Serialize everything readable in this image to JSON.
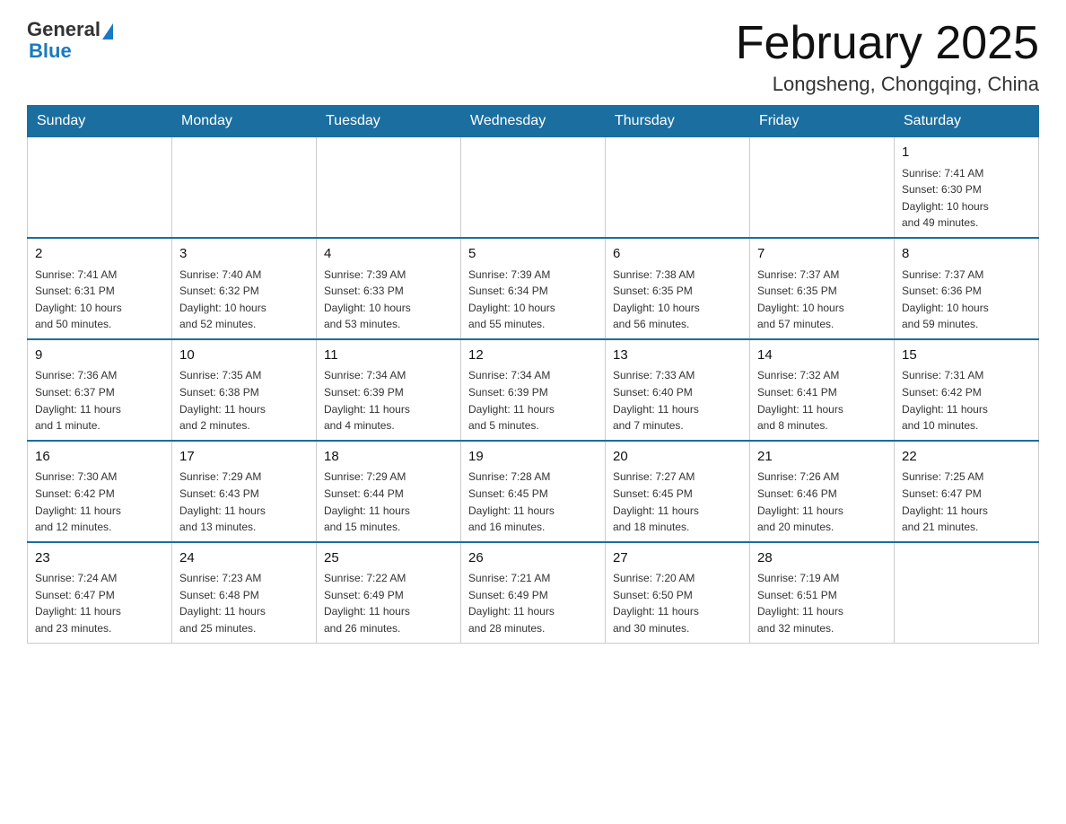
{
  "header": {
    "logo_general": "General",
    "logo_blue": "Blue",
    "month_title": "February 2025",
    "location": "Longsheng, Chongqing, China"
  },
  "days_of_week": [
    "Sunday",
    "Monday",
    "Tuesday",
    "Wednesday",
    "Thursday",
    "Friday",
    "Saturday"
  ],
  "weeks": [
    {
      "days": [
        {
          "date": "",
          "info": ""
        },
        {
          "date": "",
          "info": ""
        },
        {
          "date": "",
          "info": ""
        },
        {
          "date": "",
          "info": ""
        },
        {
          "date": "",
          "info": ""
        },
        {
          "date": "",
          "info": ""
        },
        {
          "date": "1",
          "info": "Sunrise: 7:41 AM\nSunset: 6:30 PM\nDaylight: 10 hours\nand 49 minutes."
        }
      ]
    },
    {
      "days": [
        {
          "date": "2",
          "info": "Sunrise: 7:41 AM\nSunset: 6:31 PM\nDaylight: 10 hours\nand 50 minutes."
        },
        {
          "date": "3",
          "info": "Sunrise: 7:40 AM\nSunset: 6:32 PM\nDaylight: 10 hours\nand 52 minutes."
        },
        {
          "date": "4",
          "info": "Sunrise: 7:39 AM\nSunset: 6:33 PM\nDaylight: 10 hours\nand 53 minutes."
        },
        {
          "date": "5",
          "info": "Sunrise: 7:39 AM\nSunset: 6:34 PM\nDaylight: 10 hours\nand 55 minutes."
        },
        {
          "date": "6",
          "info": "Sunrise: 7:38 AM\nSunset: 6:35 PM\nDaylight: 10 hours\nand 56 minutes."
        },
        {
          "date": "7",
          "info": "Sunrise: 7:37 AM\nSunset: 6:35 PM\nDaylight: 10 hours\nand 57 minutes."
        },
        {
          "date": "8",
          "info": "Sunrise: 7:37 AM\nSunset: 6:36 PM\nDaylight: 10 hours\nand 59 minutes."
        }
      ]
    },
    {
      "days": [
        {
          "date": "9",
          "info": "Sunrise: 7:36 AM\nSunset: 6:37 PM\nDaylight: 11 hours\nand 1 minute."
        },
        {
          "date": "10",
          "info": "Sunrise: 7:35 AM\nSunset: 6:38 PM\nDaylight: 11 hours\nand 2 minutes."
        },
        {
          "date": "11",
          "info": "Sunrise: 7:34 AM\nSunset: 6:39 PM\nDaylight: 11 hours\nand 4 minutes."
        },
        {
          "date": "12",
          "info": "Sunrise: 7:34 AM\nSunset: 6:39 PM\nDaylight: 11 hours\nand 5 minutes."
        },
        {
          "date": "13",
          "info": "Sunrise: 7:33 AM\nSunset: 6:40 PM\nDaylight: 11 hours\nand 7 minutes."
        },
        {
          "date": "14",
          "info": "Sunrise: 7:32 AM\nSunset: 6:41 PM\nDaylight: 11 hours\nand 8 minutes."
        },
        {
          "date": "15",
          "info": "Sunrise: 7:31 AM\nSunset: 6:42 PM\nDaylight: 11 hours\nand 10 minutes."
        }
      ]
    },
    {
      "days": [
        {
          "date": "16",
          "info": "Sunrise: 7:30 AM\nSunset: 6:42 PM\nDaylight: 11 hours\nand 12 minutes."
        },
        {
          "date": "17",
          "info": "Sunrise: 7:29 AM\nSunset: 6:43 PM\nDaylight: 11 hours\nand 13 minutes."
        },
        {
          "date": "18",
          "info": "Sunrise: 7:29 AM\nSunset: 6:44 PM\nDaylight: 11 hours\nand 15 minutes."
        },
        {
          "date": "19",
          "info": "Sunrise: 7:28 AM\nSunset: 6:45 PM\nDaylight: 11 hours\nand 16 minutes."
        },
        {
          "date": "20",
          "info": "Sunrise: 7:27 AM\nSunset: 6:45 PM\nDaylight: 11 hours\nand 18 minutes."
        },
        {
          "date": "21",
          "info": "Sunrise: 7:26 AM\nSunset: 6:46 PM\nDaylight: 11 hours\nand 20 minutes."
        },
        {
          "date": "22",
          "info": "Sunrise: 7:25 AM\nSunset: 6:47 PM\nDaylight: 11 hours\nand 21 minutes."
        }
      ]
    },
    {
      "days": [
        {
          "date": "23",
          "info": "Sunrise: 7:24 AM\nSunset: 6:47 PM\nDaylight: 11 hours\nand 23 minutes."
        },
        {
          "date": "24",
          "info": "Sunrise: 7:23 AM\nSunset: 6:48 PM\nDaylight: 11 hours\nand 25 minutes."
        },
        {
          "date": "25",
          "info": "Sunrise: 7:22 AM\nSunset: 6:49 PM\nDaylight: 11 hours\nand 26 minutes."
        },
        {
          "date": "26",
          "info": "Sunrise: 7:21 AM\nSunset: 6:49 PM\nDaylight: 11 hours\nand 28 minutes."
        },
        {
          "date": "27",
          "info": "Sunrise: 7:20 AM\nSunset: 6:50 PM\nDaylight: 11 hours\nand 30 minutes."
        },
        {
          "date": "28",
          "info": "Sunrise: 7:19 AM\nSunset: 6:51 PM\nDaylight: 11 hours\nand 32 minutes."
        },
        {
          "date": "",
          "info": ""
        }
      ]
    }
  ]
}
